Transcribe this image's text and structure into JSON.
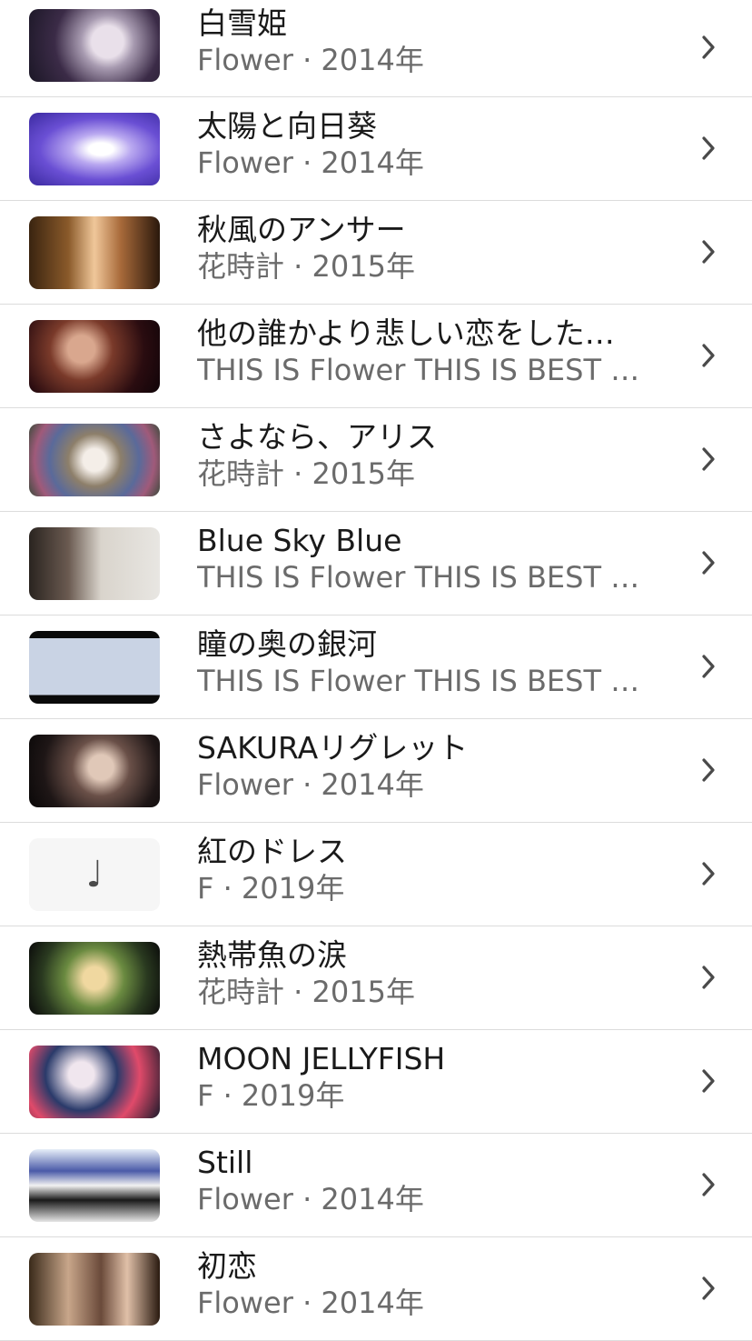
{
  "songs": [
    {
      "title": "白雪姫",
      "subtitle": "Flower · 2014年",
      "thumbnail": "video-thumbnail"
    },
    {
      "title": "太陽と向日葵",
      "subtitle": "Flower · 2014年",
      "thumbnail": "video-thumbnail"
    },
    {
      "title": "秋風のアンサー",
      "subtitle": "花時計 · 2015年",
      "thumbnail": "video-thumbnail"
    },
    {
      "title": "他の誰かより悲しい恋をした…",
      "subtitle": "THIS IS Flower THIS IS BEST …",
      "thumbnail": "video-thumbnail"
    },
    {
      "title": "さよなら、アリス",
      "subtitle": "花時計 · 2015年",
      "thumbnail": "video-thumbnail"
    },
    {
      "title": "Blue Sky Blue",
      "subtitle": "THIS IS Flower THIS IS BEST …",
      "thumbnail": "video-thumbnail"
    },
    {
      "title": "瞳の奥の銀河",
      "subtitle": "THIS IS Flower THIS IS BEST …",
      "thumbnail": "video-thumbnail"
    },
    {
      "title": "SAKURAリグレット",
      "subtitle": "Flower · 2014年",
      "thumbnail": "video-thumbnail"
    },
    {
      "title": "紅のドレス",
      "subtitle": "F · 2019年",
      "thumbnail": "music-note-icon"
    },
    {
      "title": "熱帯魚の涙",
      "subtitle": "花時計 · 2015年",
      "thumbnail": "video-thumbnail"
    },
    {
      "title": "MOON JELLYFISH",
      "subtitle": "F · 2019年",
      "thumbnail": "video-thumbnail"
    },
    {
      "title": "Still",
      "subtitle": "Flower · 2014年",
      "thumbnail": "video-thumbnail"
    },
    {
      "title": "初恋",
      "subtitle": "Flower · 2014年",
      "thumbnail": "video-thumbnail"
    }
  ],
  "icons": {
    "chevron": "chevron-right-icon",
    "placeholder": "music-note-icon",
    "placeholder_glyph": "♩"
  },
  "colors": {
    "title": "#1a1a1a",
    "subtitle": "#6b6b6b",
    "chevron": "#4a4a4a",
    "divider": "#dcdcdc"
  }
}
